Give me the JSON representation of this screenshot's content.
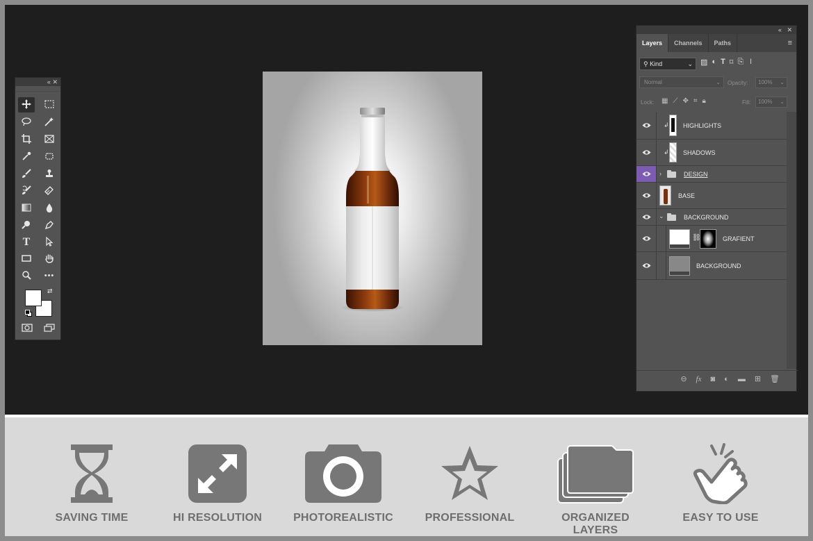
{
  "toolbar": {
    "header_collapse": "«",
    "header_close": "✕",
    "tools": [
      {
        "name": "move-tool-icon",
        "glyph": "✥"
      },
      {
        "name": "marquee-tool-icon",
        "glyph": "⬚"
      },
      {
        "name": "lasso-tool-icon",
        "glyph": "◯"
      },
      {
        "name": "magic-wand-tool-icon",
        "glyph": "✦"
      },
      {
        "name": "crop-tool-icon",
        "glyph": "⌗"
      },
      {
        "name": "frame-tool-icon",
        "glyph": "⊠"
      },
      {
        "name": "eyedropper-tool-icon",
        "glyph": "⁄"
      },
      {
        "name": "spot-healing-tool-icon",
        "glyph": "✺"
      },
      {
        "name": "brush-tool-icon",
        "glyph": "⟋"
      },
      {
        "name": "stamp-tool-icon",
        "glyph": "⊥"
      },
      {
        "name": "history-brush-tool-icon",
        "glyph": "⤳"
      },
      {
        "name": "eraser-tool-icon",
        "glyph": "⌫"
      },
      {
        "name": "gradient-tool-icon",
        "glyph": "▣"
      },
      {
        "name": "blur-tool-icon",
        "glyph": "●"
      },
      {
        "name": "dodge-tool-icon",
        "glyph": "⚲"
      },
      {
        "name": "pen-tool-icon",
        "glyph": "✒"
      },
      {
        "name": "type-tool-icon",
        "glyph": "T"
      },
      {
        "name": "path-selection-tool-icon",
        "glyph": "➤"
      },
      {
        "name": "rectangle-tool-icon",
        "glyph": "▭"
      },
      {
        "name": "hand-tool-icon",
        "glyph": "✋"
      },
      {
        "name": "zoom-tool-icon",
        "glyph": "⚲"
      },
      {
        "name": "more-tools-icon",
        "glyph": "•••"
      }
    ],
    "quick_mask_glyph": "◙",
    "screen_mode_glyph": "⧉",
    "foreground_color": "#ffffff",
    "background_color": "#ffffff"
  },
  "layers_panel": {
    "header_collapse": "«",
    "header_close": "✕",
    "tabs": [
      "Layers",
      "Channels",
      "Paths"
    ],
    "active_tab": "Layers",
    "menu_glyph": "≡",
    "filter_kind": "Kind",
    "blend_mode": "Normal",
    "opacity_label": "Opacity:",
    "opacity_value": "100%",
    "lock_label": "Lock:",
    "fill_label": "Fill:",
    "fill_value": "100%",
    "layers": [
      {
        "name": "HIGHLIGHTS",
        "type": "clipped-layer",
        "selected": false
      },
      {
        "name": "SHADOWS",
        "type": "clipped-layer",
        "selected": false
      },
      {
        "name": "DESIGN",
        "type": "group",
        "selected": true,
        "expanded": false
      },
      {
        "name": "BASE",
        "type": "layer",
        "selected": false
      },
      {
        "name": "BACKGROUND",
        "type": "group",
        "selected": false,
        "expanded": true
      },
      {
        "name": "GRAFIENT",
        "type": "layer-with-mask",
        "selected": false
      },
      {
        "name": "BACKGROUND",
        "type": "layer",
        "selected": false
      }
    ]
  },
  "features": [
    {
      "label": "SAVING TIME",
      "icon": "hourglass-icon"
    },
    {
      "label": "HI RESOLUTION",
      "icon": "expand-arrows-icon"
    },
    {
      "label": "PHOTOREALISTIC",
      "icon": "camera-icon"
    },
    {
      "label": "PROFESSIONAL",
      "icon": "star-icon"
    },
    {
      "label": "ORGANIZED LAYERS",
      "icon": "folders-icon"
    },
    {
      "label": "EASY TO USE",
      "icon": "pointing-hand-icon"
    }
  ],
  "colors": {
    "workspace": "#1e1e1e",
    "panel": "#535353",
    "selection_accent": "#7d5bb0",
    "feature_gray": "#777777",
    "bottle_amber": "#6b2a0b"
  }
}
